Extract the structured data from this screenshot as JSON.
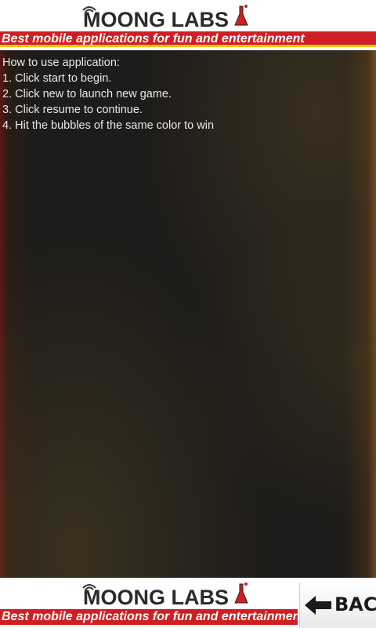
{
  "header": {
    "logo_text": "MOONG LABS",
    "tagline": "Best mobile applications for fun and entertainment"
  },
  "instructions": {
    "title": "How to use application:",
    "steps": [
      "1. Click start to begin.",
      "2. Click new to launch new game.",
      "3. Click resume to continue.",
      "4. Hit the bubbles of the same color to win"
    ]
  },
  "footer": {
    "logo_text": "MOONG LABS",
    "tagline": "Best mobile applications for fun and entertainment",
    "back_label": "BACK"
  },
  "colors": {
    "brand_red": "#cf1f22",
    "accent_yellow": "#f2cc00",
    "background": "#1b1a18",
    "text": "#e8e8e8"
  }
}
